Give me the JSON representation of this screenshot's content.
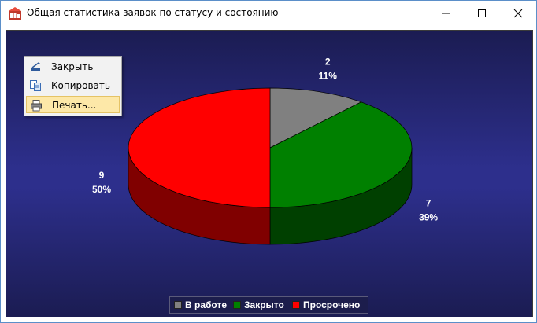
{
  "window": {
    "title": "Общая статистика заявок по статусу и состоянию"
  },
  "context_menu": {
    "items": [
      {
        "label": "Закрыть",
        "icon": "close-window-icon"
      },
      {
        "label": "Копировать",
        "icon": "copy-icon"
      },
      {
        "label": "Печать...",
        "icon": "printer-icon",
        "highlighted": true
      }
    ]
  },
  "chart_data": {
    "type": "pie",
    "three_d": true,
    "background": "dark blue gradient",
    "slices": [
      {
        "name": "В работе",
        "value": 2,
        "percent": "11%",
        "color": "#808080"
      },
      {
        "name": "Закрыто",
        "value": 7,
        "percent": "39%",
        "color": "#008000"
      },
      {
        "name": "Просрочено",
        "value": 9,
        "percent": "50%",
        "color": "#ff0000"
      }
    ],
    "labels": [
      {
        "value": "2",
        "percent": "11%"
      },
      {
        "value": "7",
        "percent": "39%"
      },
      {
        "value": "9",
        "percent": "50%"
      }
    ],
    "legend": [
      "В работе",
      "Закрыто",
      "Просрочено"
    ],
    "legend_placement": "bottom-center"
  },
  "colors": {
    "title_bar": "#ffffff",
    "menu_highlight": "#fde8a8"
  }
}
